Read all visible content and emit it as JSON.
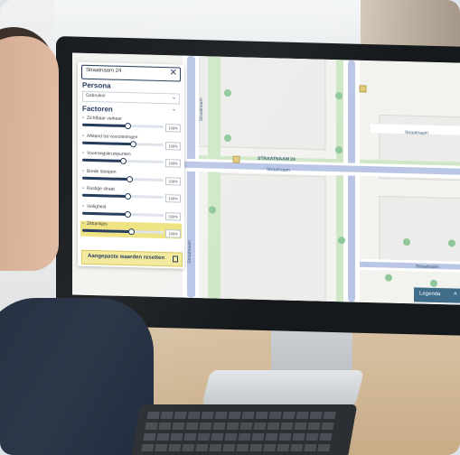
{
  "search": {
    "value": "Straatnaam 24"
  },
  "panel": {
    "persona_title": "Persona",
    "persona_value": "Gebruiker",
    "factors_title": "Factoren",
    "factors": [
      {
        "label": "Zichtbaar verkeer",
        "value": 0.55,
        "pct": "100%"
      },
      {
        "label": "Afstand tot voorzieningen",
        "value": 0.62,
        "pct": "100%"
      },
      {
        "label": "Voorrangskruispunten",
        "value": 0.5,
        "pct": "100%"
      },
      {
        "label": "Brede stoepen",
        "value": 0.58,
        "pct": "100%"
      },
      {
        "label": "Rustige straat",
        "value": 0.55,
        "pct": "100%"
      },
      {
        "label": "Veiligheid",
        "value": 0.56,
        "pct": "100%"
      },
      {
        "label": "Zitbankjes",
        "value": 0.6,
        "pct": "100%"
      }
    ],
    "reset_label": "Aangepaste waarden resetten"
  },
  "map": {
    "street_labels": [
      "Straatnaam",
      "STRAATNAAM 24",
      "Straatnaam",
      "Straatnaam",
      "Straatnaam",
      "Straatnaam"
    ],
    "legend_label": "Legenda"
  },
  "colors": {
    "accent": "#1d3557",
    "highlight": "#eee27d",
    "legend_bg": "#3f6d8a",
    "road_blue": "#b9c6e6",
    "green": "#cfe7c7"
  },
  "icons": {
    "close": "close-icon",
    "chevron": "chevron-down-icon",
    "trash": "trash-icon",
    "tree": "tree-icon"
  }
}
